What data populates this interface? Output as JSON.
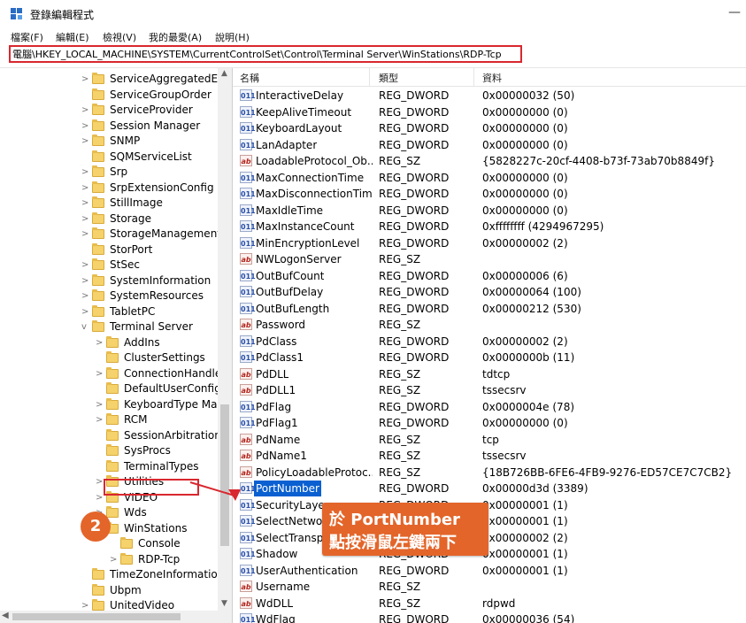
{
  "window": {
    "title": "登錄編輯程式",
    "minimize_glyph": "—"
  },
  "menu": [
    "檔案(F)",
    "編輯(E)",
    "檢視(V)",
    "我的最愛(A)",
    "說明(H)"
  ],
  "address": "電腦\\HKEY_LOCAL_MACHINE\\SYSTEM\\CurrentControlSet\\Control\\Terminal Server\\WinStations\\RDP-Tcp",
  "tree": [
    {
      "label": "ServiceAggregatedEv",
      "chev": ">"
    },
    {
      "label": "ServiceGroupOrder",
      "chev": ""
    },
    {
      "label": "ServiceProvider",
      "chev": ">"
    },
    {
      "label": "Session Manager",
      "chev": ">"
    },
    {
      "label": "SNMP",
      "chev": ">"
    },
    {
      "label": "SQMServiceList",
      "chev": ""
    },
    {
      "label": "Srp",
      "chev": ">"
    },
    {
      "label": "SrpExtensionConfig",
      "chev": ">"
    },
    {
      "label": "StillImage",
      "chev": ">"
    },
    {
      "label": "Storage",
      "chev": ">"
    },
    {
      "label": "StorageManagement",
      "chev": ">"
    },
    {
      "label": "StorPort",
      "chev": ""
    },
    {
      "label": "StSec",
      "chev": ">"
    },
    {
      "label": "SystemInformation",
      "chev": ">"
    },
    {
      "label": "SystemResources",
      "chev": ">"
    },
    {
      "label": "TabletPC",
      "chev": ">"
    },
    {
      "label": "Terminal Server",
      "chev": "v"
    },
    {
      "label": "AddIns",
      "chev": ">"
    },
    {
      "label": "ClusterSettings",
      "chev": ""
    },
    {
      "label": "ConnectionHandle",
      "chev": ">"
    },
    {
      "label": "DefaultUserConfig",
      "chev": ""
    },
    {
      "label": "KeyboardType Ma",
      "chev": ">"
    },
    {
      "label": "RCM",
      "chev": ">"
    },
    {
      "label": "SessionArbitration",
      "chev": ""
    },
    {
      "label": "SysProcs",
      "chev": ""
    },
    {
      "label": "TerminalTypes",
      "chev": ""
    },
    {
      "label": "Utilities",
      "chev": ">"
    },
    {
      "label": "VIDEO",
      "chev": ">"
    },
    {
      "label": "Wds",
      "chev": ">"
    },
    {
      "label": "WinStations",
      "chev": "v"
    },
    {
      "label": "Console",
      "chev": ""
    },
    {
      "label": "RDP-Tcp",
      "chev": ">"
    },
    {
      "label": "TimeZoneInformation",
      "chev": ""
    },
    {
      "label": "Ubpm",
      "chev": ""
    },
    {
      "label": "UnitedVideo",
      "chev": ">"
    }
  ],
  "columns": [
    "名稱",
    "類型",
    "資料"
  ],
  "values": [
    {
      "name": "InteractiveDelay",
      "type": "REG_DWORD",
      "data": "0x00000032 (50)",
      "icon": "dword"
    },
    {
      "name": "KeepAliveTimeout",
      "type": "REG_DWORD",
      "data": "0x00000000 (0)",
      "icon": "dword"
    },
    {
      "name": "KeyboardLayout",
      "type": "REG_DWORD",
      "data": "0x00000000 (0)",
      "icon": "dword"
    },
    {
      "name": "LanAdapter",
      "type": "REG_DWORD",
      "data": "0x00000000 (0)",
      "icon": "dword"
    },
    {
      "name": "LoadableProtocol_Ob...",
      "type": "REG_SZ",
      "data": "{5828227c-20cf-4408-b73f-73ab70b8849f}",
      "icon": "sz"
    },
    {
      "name": "MaxConnectionTime",
      "type": "REG_DWORD",
      "data": "0x00000000 (0)",
      "icon": "dword"
    },
    {
      "name": "MaxDisconnectionTime",
      "type": "REG_DWORD",
      "data": "0x00000000 (0)",
      "icon": "dword"
    },
    {
      "name": "MaxIdleTime",
      "type": "REG_DWORD",
      "data": "0x00000000 (0)",
      "icon": "dword"
    },
    {
      "name": "MaxInstanceCount",
      "type": "REG_DWORD",
      "data": "0xffffffff (4294967295)",
      "icon": "dword"
    },
    {
      "name": "MinEncryptionLevel",
      "type": "REG_DWORD",
      "data": "0x00000002 (2)",
      "icon": "dword"
    },
    {
      "name": "NWLogonServer",
      "type": "REG_SZ",
      "data": "",
      "icon": "sz"
    },
    {
      "name": "OutBufCount",
      "type": "REG_DWORD",
      "data": "0x00000006 (6)",
      "icon": "dword"
    },
    {
      "name": "OutBufDelay",
      "type": "REG_DWORD",
      "data": "0x00000064 (100)",
      "icon": "dword"
    },
    {
      "name": "OutBufLength",
      "type": "REG_DWORD",
      "data": "0x00000212 (530)",
      "icon": "dword"
    },
    {
      "name": "Password",
      "type": "REG_SZ",
      "data": "",
      "icon": "sz"
    },
    {
      "name": "PdClass",
      "type": "REG_DWORD",
      "data": "0x00000002 (2)",
      "icon": "dword"
    },
    {
      "name": "PdClass1",
      "type": "REG_DWORD",
      "data": "0x0000000b (11)",
      "icon": "dword"
    },
    {
      "name": "PdDLL",
      "type": "REG_SZ",
      "data": "tdtcp",
      "icon": "sz"
    },
    {
      "name": "PdDLL1",
      "type": "REG_SZ",
      "data": "tssecsrv",
      "icon": "sz"
    },
    {
      "name": "PdFlag",
      "type": "REG_DWORD",
      "data": "0x0000004e (78)",
      "icon": "dword"
    },
    {
      "name": "PdFlag1",
      "type": "REG_DWORD",
      "data": "0x00000000 (0)",
      "icon": "dword"
    },
    {
      "name": "PdName",
      "type": "REG_SZ",
      "data": "tcp",
      "icon": "sz"
    },
    {
      "name": "PdName1",
      "type": "REG_SZ",
      "data": "tssecsrv",
      "icon": "sz"
    },
    {
      "name": "PolicyLoadableProtoc...",
      "type": "REG_SZ",
      "data": "{18B726BB-6FE6-4FB9-9276-ED57CE7C7CB2}",
      "icon": "sz"
    },
    {
      "name": "PortNumber",
      "type": "REG_DWORD",
      "data": "0x00000d3d (3389)",
      "icon": "dword",
      "selected": true
    },
    {
      "name": "SecurityLayer",
      "type": "REG_DWORD",
      "data": "0x00000001 (1)",
      "icon": "dword"
    },
    {
      "name": "SelectNetwork",
      "type": "REG_DWORD",
      "data": "0x00000001 (1)",
      "icon": "dword"
    },
    {
      "name": "SelectTransport",
      "type": "REG_DWORD",
      "data": "0x00000002 (2)",
      "icon": "dword"
    },
    {
      "name": "Shadow",
      "type": "REG_DWORD",
      "data": "0x00000001 (1)",
      "icon": "dword"
    },
    {
      "name": "UserAuthentication",
      "type": "REG_DWORD",
      "data": "0x00000001 (1)",
      "icon": "dword"
    },
    {
      "name": "Username",
      "type": "REG_SZ",
      "data": "",
      "icon": "sz"
    },
    {
      "name": "WdDLL",
      "type": "REG_SZ",
      "data": "rdpwd",
      "icon": "sz"
    },
    {
      "name": "WdFlag",
      "type": "REG_DWORD",
      "data": "0x00000036 (54)",
      "icon": "dword"
    }
  ],
  "annotation": {
    "step": "2",
    "line1": "於 PortNumber",
    "line2": "點按滑鼠左鍵兩下",
    "color": "#e3652a",
    "box_color": "#d9272e"
  },
  "icons": {
    "dword_glyph": "011",
    "sz_glyph": "ab",
    "tree_expand": ">",
    "tree_collapse": "v"
  }
}
